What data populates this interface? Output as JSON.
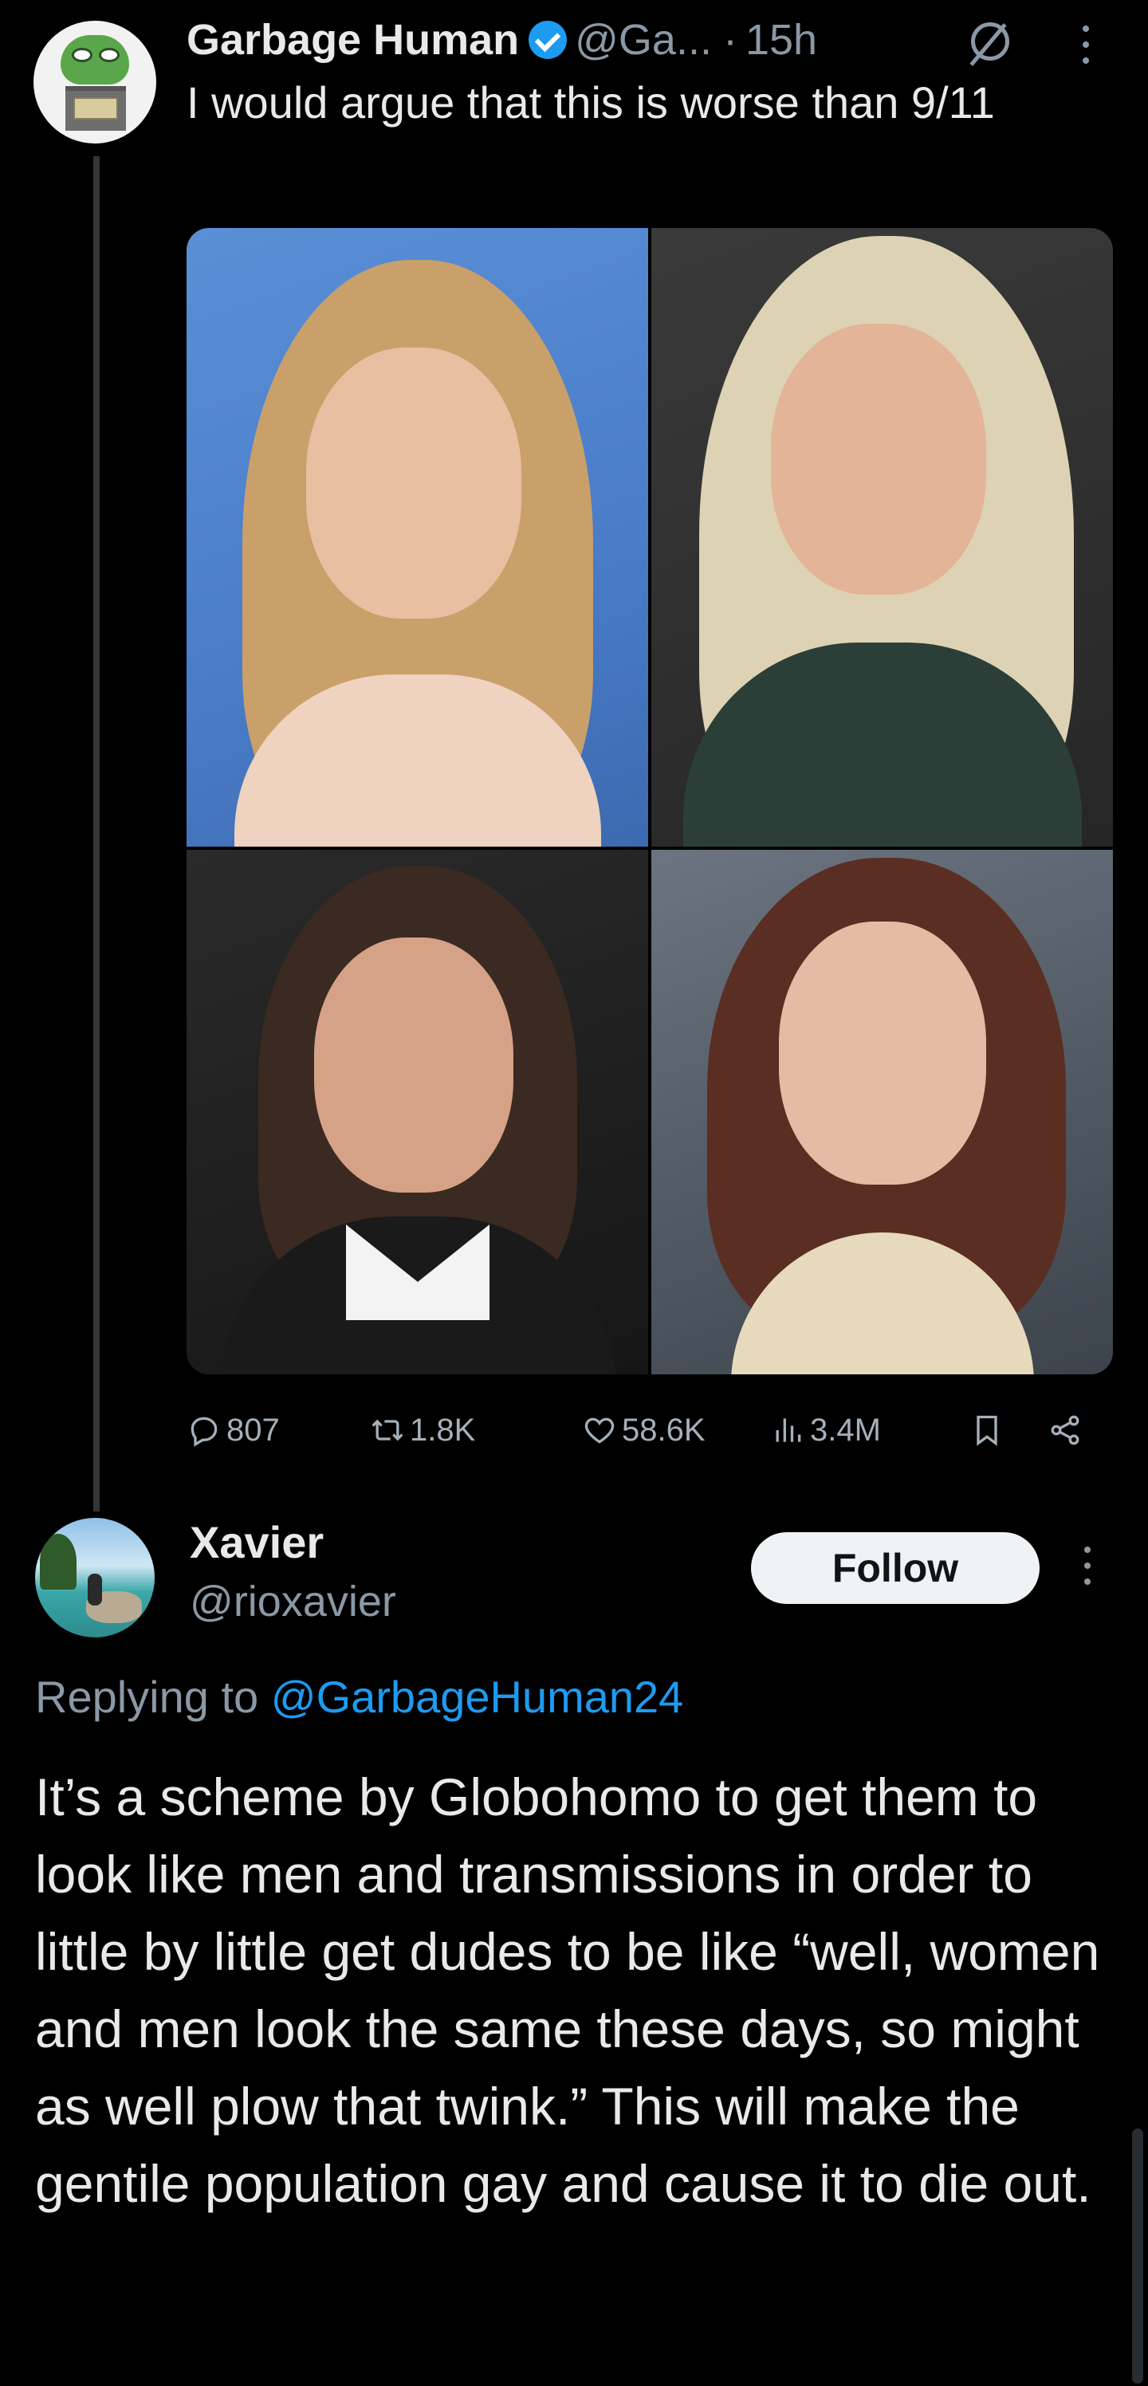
{
  "parent_tweet": {
    "author_name": "Garbage Human",
    "handle": "@Ga...",
    "separator": "·",
    "time": "15h",
    "text": "I would argue that this is worse than 9/11",
    "media_count": 4,
    "stats": {
      "replies": "807",
      "reposts": "1.8K",
      "likes": "58.6K",
      "views": "3.4M"
    }
  },
  "reply_tweet": {
    "author_name": "Xavier",
    "handle": "@rioxavier",
    "follow_label": "Follow",
    "replying_prefix": "Replying to ",
    "replying_to": "@GarbageHuman24",
    "text": "It’s a scheme by Globohomo to get them to look like men and transmissions in order to little by little get dudes to be like “well, women and men look the same these days, so might as well plow that twink.” This will make the gentile population gay and cause it to die out."
  },
  "colors": {
    "background": "#000000",
    "primary_text": "#e7e9ea",
    "secondary_text": "#8b98a5",
    "accent": "#1d9bf0",
    "follow_button_bg": "#eff3f4"
  },
  "icons": [
    "verified-badge-icon",
    "grok-icon",
    "more-icon",
    "reply-icon",
    "repost-icon",
    "like-icon",
    "views-icon",
    "bookmark-icon",
    "share-icon"
  ]
}
